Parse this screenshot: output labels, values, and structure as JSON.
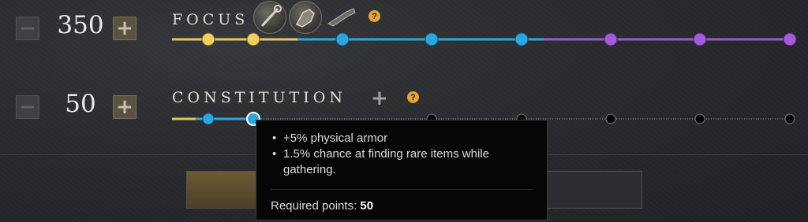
{
  "attributes": [
    {
      "name": "FOCUS",
      "points": "350",
      "decrease_label": "−",
      "increase_label": "+",
      "help_symbol": "?",
      "weapons": [
        "life-staff-icon",
        "void-gauntlet-icon",
        "blunderbuss-icon"
      ],
      "track": {
        "milestones": [
          "gold-reached",
          "gold-reached",
          "blue-reached",
          "blue-reached",
          "blue-reached",
          "purple-reached",
          "purple-reached",
          "purple-reached"
        ],
        "progress_fraction": 1.0
      }
    },
    {
      "name": "CONSTITUTION",
      "points": "50",
      "decrease_label": "−",
      "increase_label": "+",
      "help_symbol": "?",
      "bonus_icon": "plus-icon",
      "track": {
        "milestones": [
          "blue-reached",
          "blue-reached",
          "locked",
          "locked",
          "locked",
          "locked",
          "locked",
          "locked"
        ],
        "progress_fraction": 0.13
      }
    }
  ],
  "tooltip": {
    "bullets": [
      "+5% physical armor",
      "1.5% chance at finding rare items while gathering."
    ],
    "required_label": "Required points:",
    "required_value": "50"
  },
  "colors": {
    "gold": "#e8c65a",
    "blue": "#2aa7df",
    "purple": "#9b57d0",
    "help": "#e6a532"
  }
}
